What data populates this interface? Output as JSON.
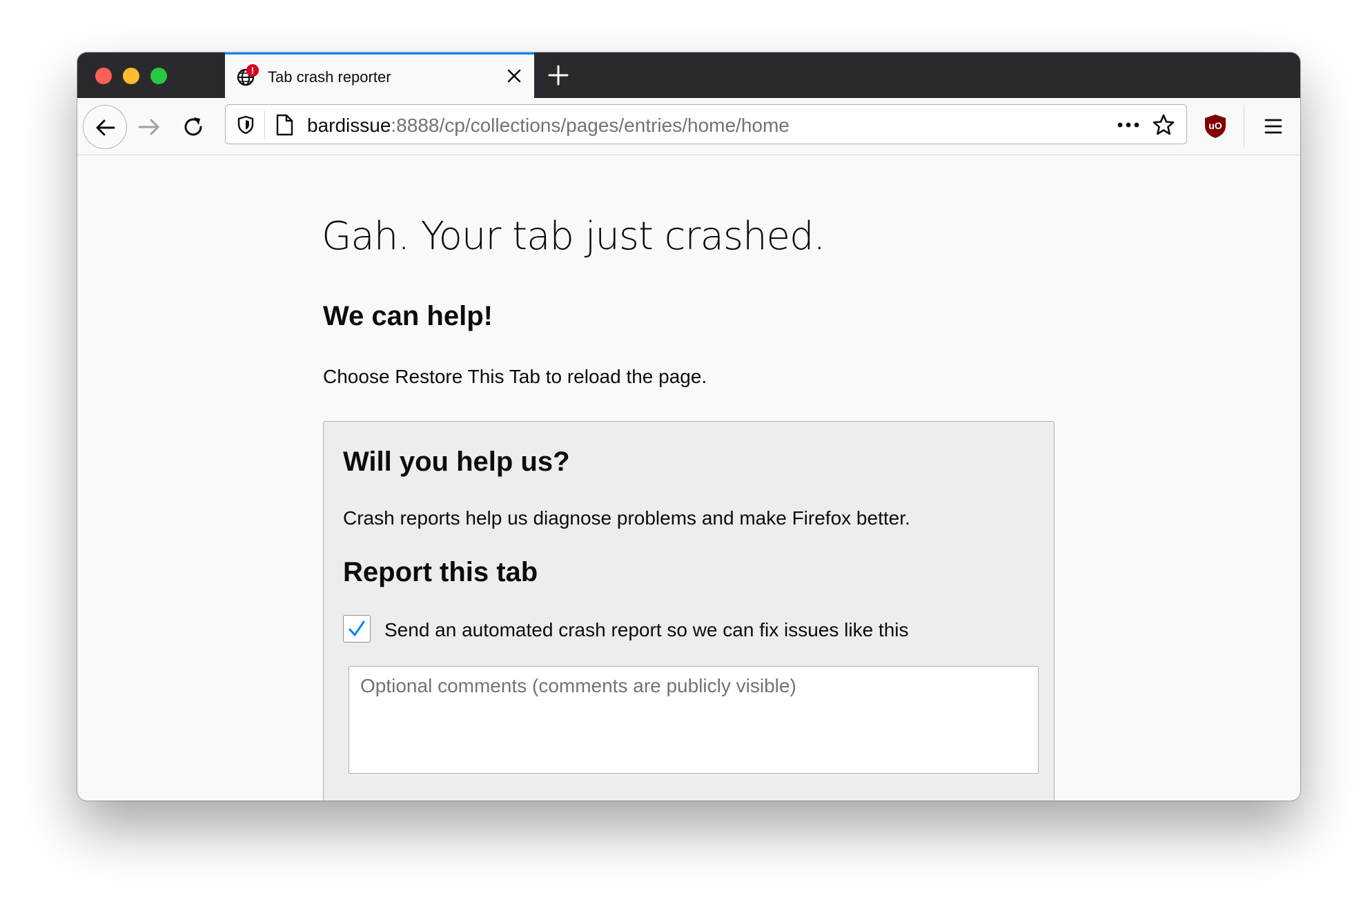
{
  "browser": {
    "tab": {
      "title": "Tab crash reporter",
      "favicon": "globe-crash-icon",
      "badge": "!"
    },
    "url": {
      "host": "bardissue",
      "rest": ":8888/cp/collections/pages/entries/home/home"
    },
    "icons": {
      "back": "back-arrow-icon",
      "forward": "forward-arrow-icon",
      "reload": "reload-icon",
      "shield": "tracking-shield-icon",
      "page": "page-icon",
      "more": "more-actions-icon",
      "bookmark": "bookmark-star-icon",
      "extension": "ublock-icon",
      "menu": "hamburger-menu-icon",
      "new_tab": "plus-icon",
      "close_tab": "close-icon"
    },
    "colors": {
      "titlebar": "#2a2a2e",
      "tab_accent": "#0a84ff",
      "traffic_red": "#fe5f57",
      "traffic_yellow": "#febc2e",
      "traffic_green": "#28c840",
      "badge": "#d70022",
      "ublock": "#800000"
    }
  },
  "page": {
    "title": "Gah. Your tab just crashed.",
    "help_heading": "We can help!",
    "restore_text": "Choose Restore This Tab to reload the page.",
    "help_box": {
      "heading": "Will you help us?",
      "description": "Crash reports help us diagnose problems and make Firefox better.",
      "report_heading": "Report this tab",
      "checkbox_label": "Send an automated crash report so we can fix issues like this",
      "checkbox_checked": true,
      "comments_placeholder": "Optional comments (comments are publicly visible)",
      "comments_value": ""
    }
  }
}
